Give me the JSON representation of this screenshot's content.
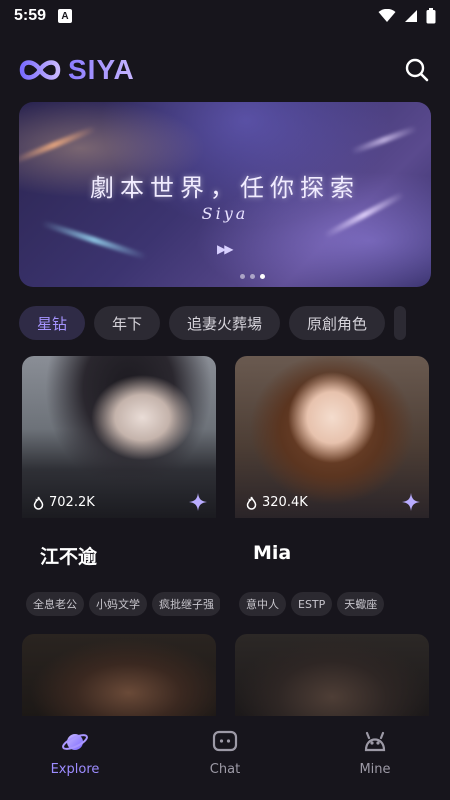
{
  "status_bar": {
    "time": "5:59",
    "notification_icon": "A"
  },
  "header": {
    "app_name": "SIYA",
    "search_icon": "search-icon"
  },
  "banner": {
    "title": "劇本世界，任你探索",
    "subtitle": "Siya",
    "page_count": 3,
    "active_page": 3
  },
  "tags": [
    {
      "label": "星钻",
      "active": true
    },
    {
      "label": "年下",
      "active": false
    },
    {
      "label": "追妻火葬場",
      "active": false
    },
    {
      "label": "原創角色",
      "active": false
    }
  ],
  "cards": [
    {
      "name": "江不逾",
      "count": "702.2K",
      "tags": [
        "全息老公",
        "小妈文学",
        "疯批继子强"
      ]
    },
    {
      "name": "Mia",
      "count": "320.4K",
      "tags": [
        "意中人",
        "ESTP",
        "天蠍座"
      ]
    }
  ],
  "tab_bar": {
    "items": [
      {
        "label": "Explore",
        "icon": "planet-icon",
        "active": true
      },
      {
        "label": "Chat",
        "icon": "chat-icon",
        "active": false
      },
      {
        "label": "Mine",
        "icon": "profile-icon",
        "active": false
      }
    ]
  },
  "colors": {
    "accent": "#9d8cff",
    "background": "#17151c",
    "chip": "#2c2a33"
  }
}
